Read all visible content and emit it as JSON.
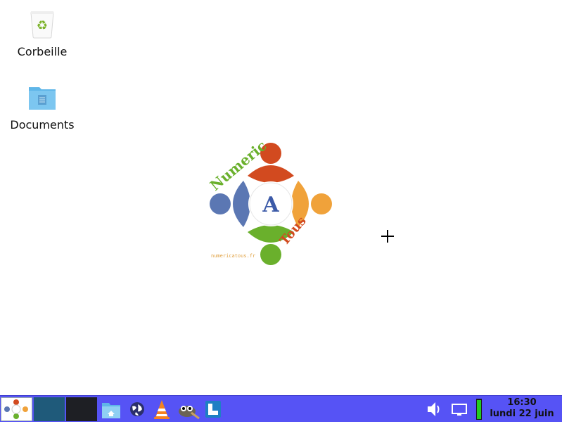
{
  "desktop": {
    "icons": [
      {
        "label": "Corbeille",
        "icon": "trash-icon"
      },
      {
        "label": "Documents",
        "icon": "folder-icon"
      }
    ],
    "wallpaper_logo": {
      "arc_text_top": "Numeric",
      "arc_text_bottom": "Tous",
      "center_letter": "A",
      "small_text": "numericatous.fr",
      "colors": {
        "top": "#d24a1f",
        "left": "#5b77b3",
        "right": "#f0a23a",
        "bottom": "#6ab02c"
      }
    }
  },
  "taskbar": {
    "background": "#5653f5",
    "launchers": [
      "app-menu-icon",
      "workspace-1",
      "workspace-2",
      "file-manager-icon",
      "web-browser-icon",
      "vlc-icon",
      "gimp-icon",
      "document-viewer-icon"
    ],
    "tray": [
      "volume-icon",
      "display-icon",
      "battery-icon"
    ],
    "clock": {
      "time": "16:30",
      "date": "lundi 22 juin"
    }
  }
}
